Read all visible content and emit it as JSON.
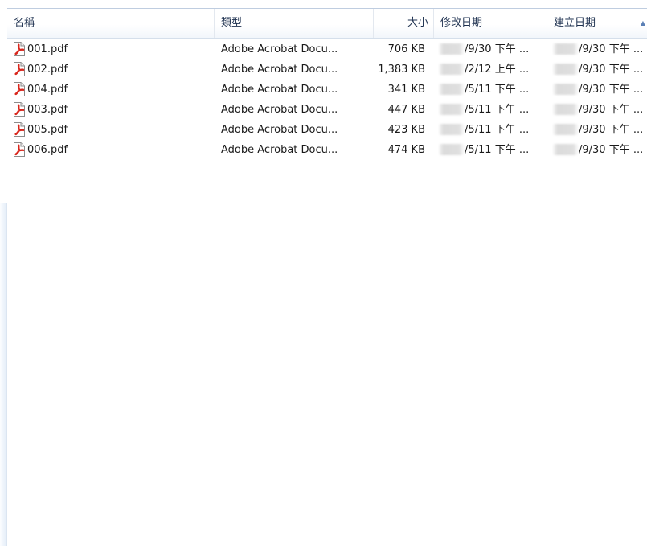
{
  "columns": {
    "name": "名稱",
    "type": "類型",
    "size": "大小",
    "modified": "修改日期",
    "created": "建立日期"
  },
  "sort_indicator": "▲",
  "files": [
    {
      "name": "001.pdf",
      "type": "Adobe Acrobat Docu...",
      "size": "706 KB",
      "modified": "/9/30 下午 ...",
      "created": "/9/30 下午 ..."
    },
    {
      "name": "002.pdf",
      "type": "Adobe Acrobat Docu...",
      "size": "1,383 KB",
      "modified": "/2/12 上午 ...",
      "created": "/9/30 下午 ..."
    },
    {
      "name": "004.pdf",
      "type": "Adobe Acrobat Docu...",
      "size": "341 KB",
      "modified": "/5/11 下午 ...",
      "created": "/9/30 下午 ..."
    },
    {
      "name": "003.pdf",
      "type": "Adobe Acrobat Docu...",
      "size": "447 KB",
      "modified": "/5/11 下午 ...",
      "created": "/9/30 下午 ..."
    },
    {
      "name": "005.pdf",
      "type": "Adobe Acrobat Docu...",
      "size": "423 KB",
      "modified": "/5/11 下午 ...",
      "created": "/9/30 下午 ..."
    },
    {
      "name": "006.pdf",
      "type": "Adobe Acrobat Docu...",
      "size": "474 KB",
      "modified": "/5/11 下午 ...",
      "created": "/9/30 下午 ..."
    }
  ],
  "colors": {
    "pdf_icon_red": "#d9261c",
    "header_text": "#1e3150",
    "sort_arrow": "#5a7fb5"
  }
}
